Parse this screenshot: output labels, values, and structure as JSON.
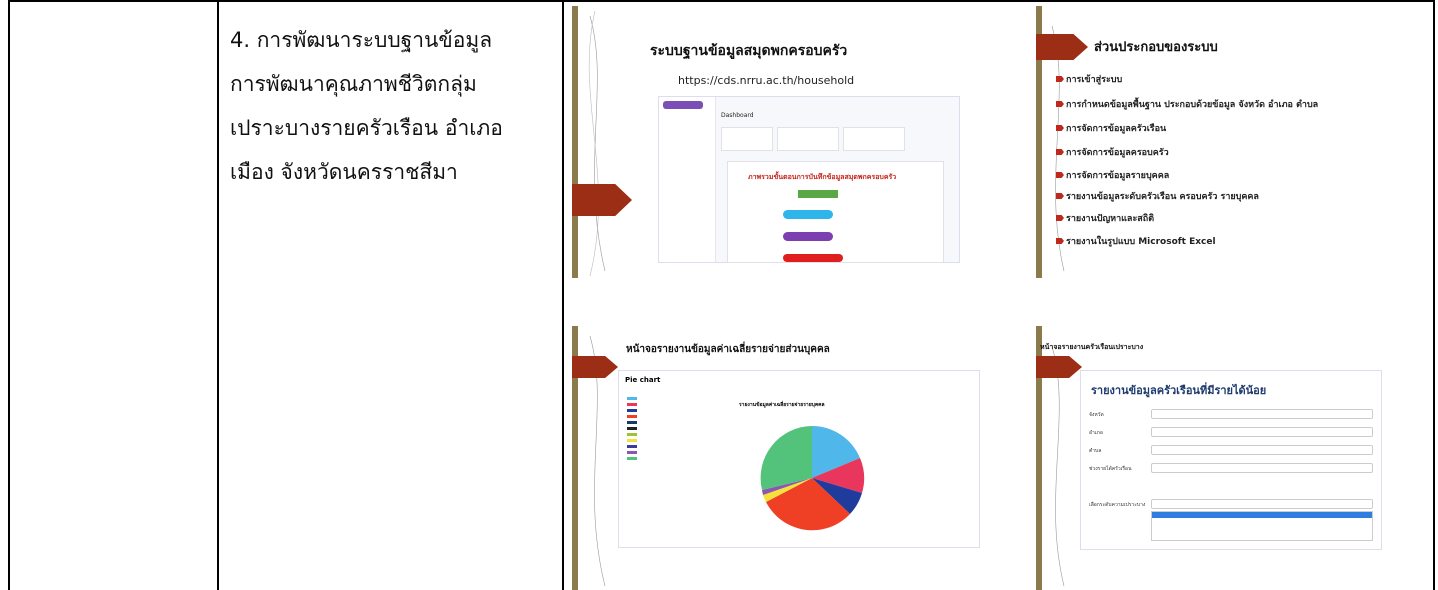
{
  "row_text": "4. การพัฒนาระบบฐานข้อมูลการพัฒนาคุณภาพชีวิตกลุ่มเปราะบางรายครัวเรือน อำเภอเมือง จังหวัดนครราชสีมา",
  "row_lines": [
    "4. การพัฒนาระบบฐานข้อมูล",
    "การพัฒนาคุณภาพชีวิตกลุ่ม",
    "เปราะบางรายครัวเรือน อำเภอ",
    "เมือง จังหวัดนครราชสีมา"
  ],
  "slide1": {
    "title": "ระบบฐานข้อมูลสมุดพกครอบครัว",
    "url": "https://cds.nrru.ac.th/household",
    "flow_title": "ภาพรวมขั้นตอนการบันทึกข้อมูลสมุดพกครอบครัว",
    "dashboard_label": "Dashboard"
  },
  "slide2": {
    "title": "ส่วนประกอบของระบบ",
    "items": [
      "การเข้าสู่ระบบ",
      "การกำหนดข้อมูลพื้นฐาน ประกอบด้วยข้อมูล จังหวัด อำเภอ ตำบล",
      "การจัดการข้อมูลครัวเรือน",
      "การจัดการข้อมูลครอบครัว",
      "การจัดการข้อมูลรายบุคคล",
      "รายงานข้อมูลระดับครัวเรือน ครอบครัว รายบุคคล",
      "รายงานปัญหาและสถิติ",
      "รายงานในรูปแบบ Microsoft Excel"
    ]
  },
  "slide3": {
    "title": "หน้าจอรายงานข้อมูลค่าเฉลี่ยรายจ่ายส่วนบุคคล",
    "panel_label": "Pie chart",
    "chart_title": "รายงานข้อมูลค่าเฉลี่ยรายจ่ายรายบุคคล"
  },
  "slide4": {
    "title": "หน้าจอรายงานครัวเรือนเปราะบาง",
    "report_title": "รายงานข้อมูลครัวเรือนที่มีรายได้น้อย",
    "fields": [
      "จังหวัด",
      "อำเภอ",
      "ตำบล",
      "ช่วงรายได้ครัวเรือน",
      "เลือกระดับความเปราะบาง"
    ]
  },
  "colors": {
    "arrow": "#9b2e14",
    "border": "#000000"
  }
}
